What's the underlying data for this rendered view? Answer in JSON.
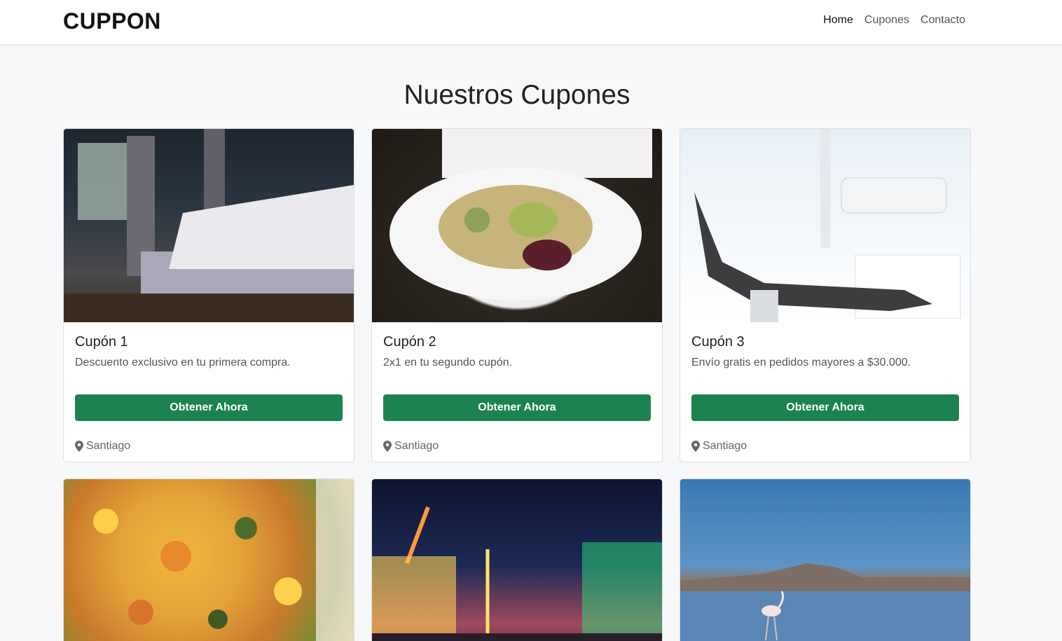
{
  "nav": {
    "brand": "CUPPON",
    "links": [
      "Home",
      "Cupones",
      "Contacto"
    ]
  },
  "main": {
    "title": "Nuestros Cupones",
    "cards": [
      {
        "title": "Cupón 1",
        "text": "Descuento exclusivo en tu primera compra.",
        "button": "Obtener Ahora",
        "location": "Santiago",
        "image": "bedroom"
      },
      {
        "title": "Cupón 2",
        "text": "2x1 en tu segundo cupón.",
        "button": "Obtener Ahora",
        "location": "Santiago",
        "image": "salad-plate"
      },
      {
        "title": "Cupón 3",
        "text": "Envío gratis en pedidos mayores a $30.000.",
        "button": "Obtener Ahora",
        "location": "Santiago",
        "image": "dental-chair"
      },
      {
        "image": "vegetable-dish"
      },
      {
        "image": "night-fair"
      },
      {
        "image": "flamingo-lake"
      }
    ]
  },
  "colors": {
    "button": "#1c8350",
    "background": "#f7f8f9"
  },
  "icons": {
    "location": "map-pin-icon"
  }
}
